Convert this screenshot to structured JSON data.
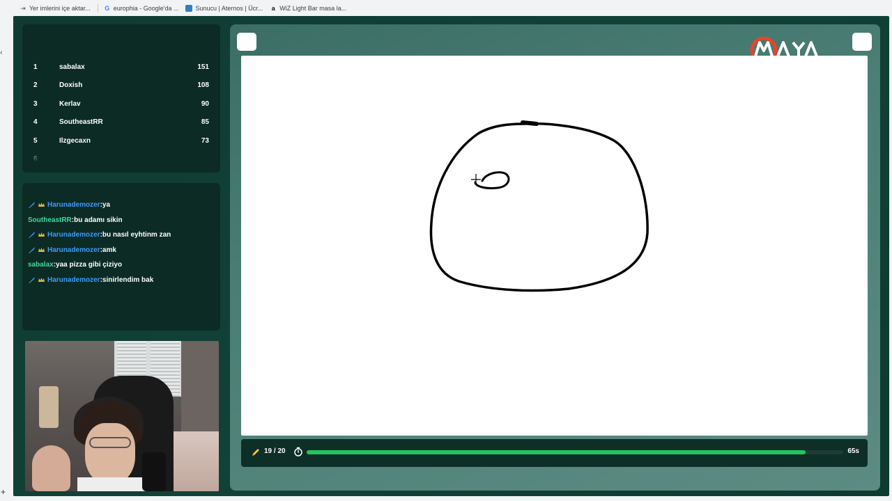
{
  "bookmarks": [
    {
      "label": "Yer imlerini içe aktar...",
      "icon": "import-icon"
    },
    {
      "label": "europhia - Google'da ...",
      "icon": "google-icon"
    },
    {
      "label": "Sunucu | Aternos | Ücr...",
      "icon": "aternos-icon"
    },
    {
      "label": "WiZ Light Bar masa la...",
      "icon": "amazon-icon"
    }
  ],
  "leaderboard": [
    {
      "rank": "1",
      "name": "sabalax",
      "score": "151"
    },
    {
      "rank": "2",
      "name": "Doxish",
      "score": "108"
    },
    {
      "rank": "3",
      "name": "Kerlav",
      "score": "90"
    },
    {
      "rank": "4",
      "name": "SoutheastRR",
      "score": "85"
    },
    {
      "rank": "5",
      "name": "Ilzgecaxn",
      "score": "73"
    },
    {
      "rank": "6",
      "name": "",
      "score": ""
    }
  ],
  "chat": [
    {
      "user": "Harunademozer",
      "message": "ya",
      "user_color": "#3b9cff",
      "badges": true
    },
    {
      "user": "SoutheastRR",
      "message": "bu adamı sikin",
      "user_color": "#3ddc97",
      "badges": false
    },
    {
      "user": "Harunademozer",
      "message": "bu nasıl eyhtinm zan",
      "user_color": "#3b9cff",
      "badges": true
    },
    {
      "user": "Harunademozer",
      "message": "amk",
      "user_color": "#3b9cff",
      "badges": true
    },
    {
      "user": "sabalax",
      "message": "yaa pizza gibi çiziyo",
      "user_color": "#3ddc97",
      "badges": false
    },
    {
      "user": "Harunademozer",
      "message": "sinirlendim bak",
      "user_color": "#3b9cff",
      "badges": true
    }
  ],
  "game": {
    "round": "19 / 20",
    "time_left": "65s",
    "progress_fraction": 0.93,
    "accent_color": "#22c55e"
  },
  "brand": {
    "logo_icon": "maya-logo-icon",
    "logo_color": "#e8452a"
  }
}
